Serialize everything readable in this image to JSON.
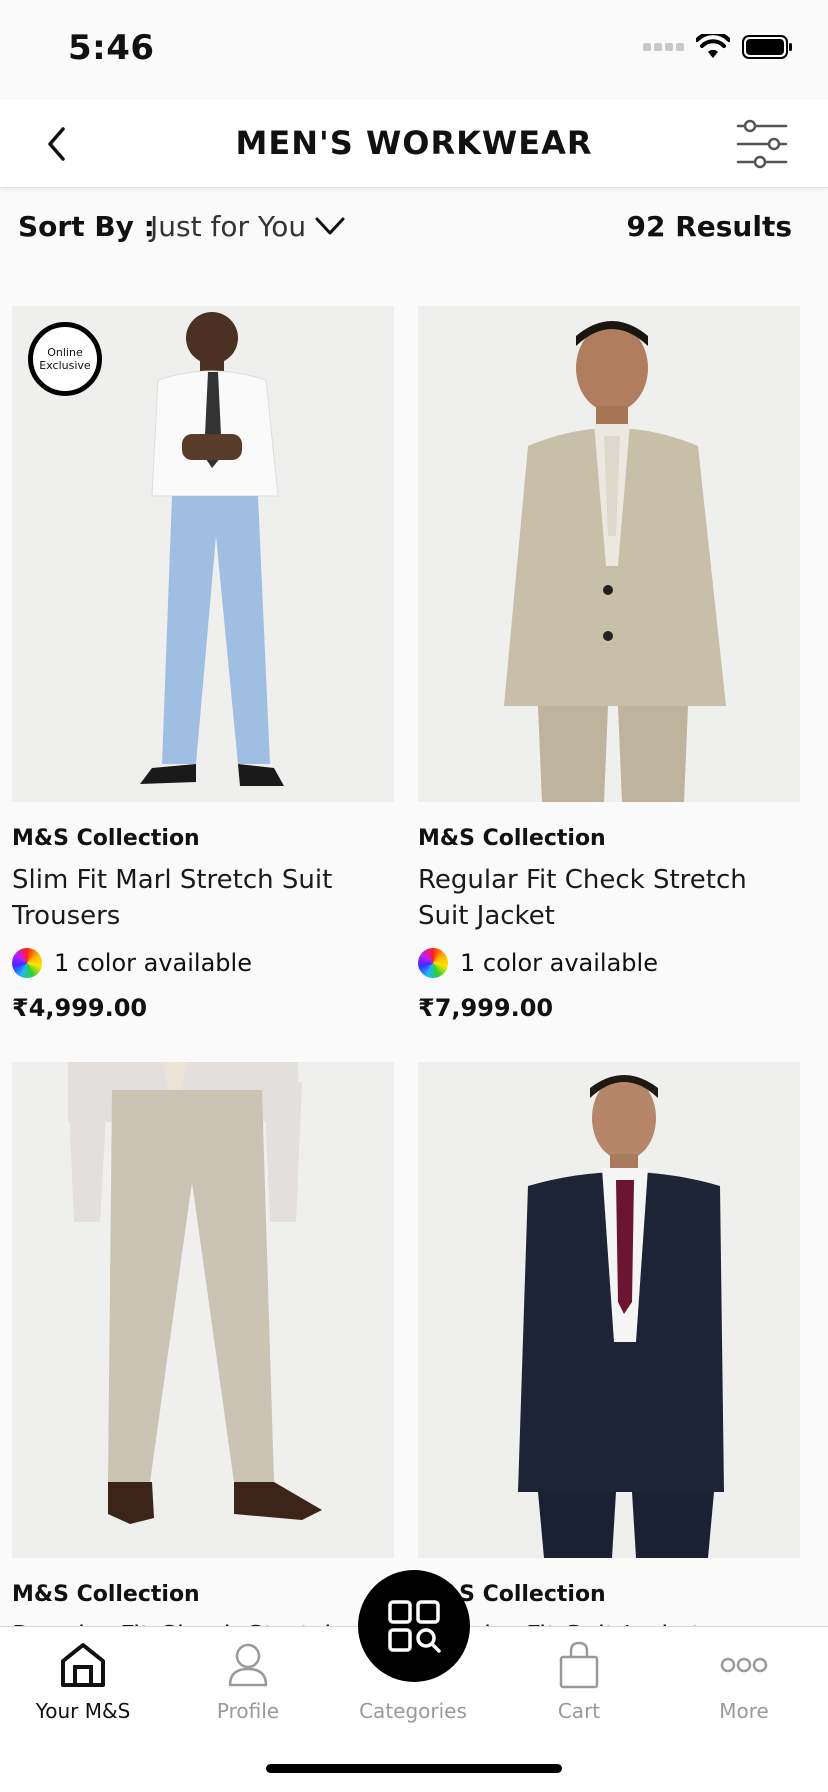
{
  "status": {
    "time": "5:46"
  },
  "header": {
    "title": "MEN'S WORKWEAR"
  },
  "sort": {
    "label": "Sort By :",
    "value": "Just for You",
    "results": "92 Results"
  },
  "products": [
    {
      "badge_line1": "Online",
      "badge_line2": "Exclusive",
      "brand": "M&S Collection",
      "name": "Slim Fit Marl Stretch Suit Trousers",
      "colors": "1 color available",
      "price": "₹4,999.00"
    },
    {
      "brand": "M&S Collection",
      "name": "Regular Fit Check Stretch Suit Jacket",
      "colors": "1 color available",
      "price": "₹7,999.00"
    },
    {
      "brand": "M&S Collection",
      "name": "Regular Fit Check Stretch"
    },
    {
      "brand": "M&S Collection",
      "name": "Regular Fit Suit Jacket"
    }
  ],
  "bottom_nav": {
    "items": [
      {
        "label": "Your M&S",
        "icon": "home-icon"
      },
      {
        "label": "Profile",
        "icon": "profile-icon"
      },
      {
        "label": "Categories",
        "icon": "categories-icon"
      },
      {
        "label": "Cart",
        "icon": "cart-icon"
      },
      {
        "label": "More",
        "icon": "more-icon"
      }
    ]
  },
  "colors": {
    "accent": "#000000",
    "inactive": "#9a9a9a",
    "background": "#fafafa"
  }
}
